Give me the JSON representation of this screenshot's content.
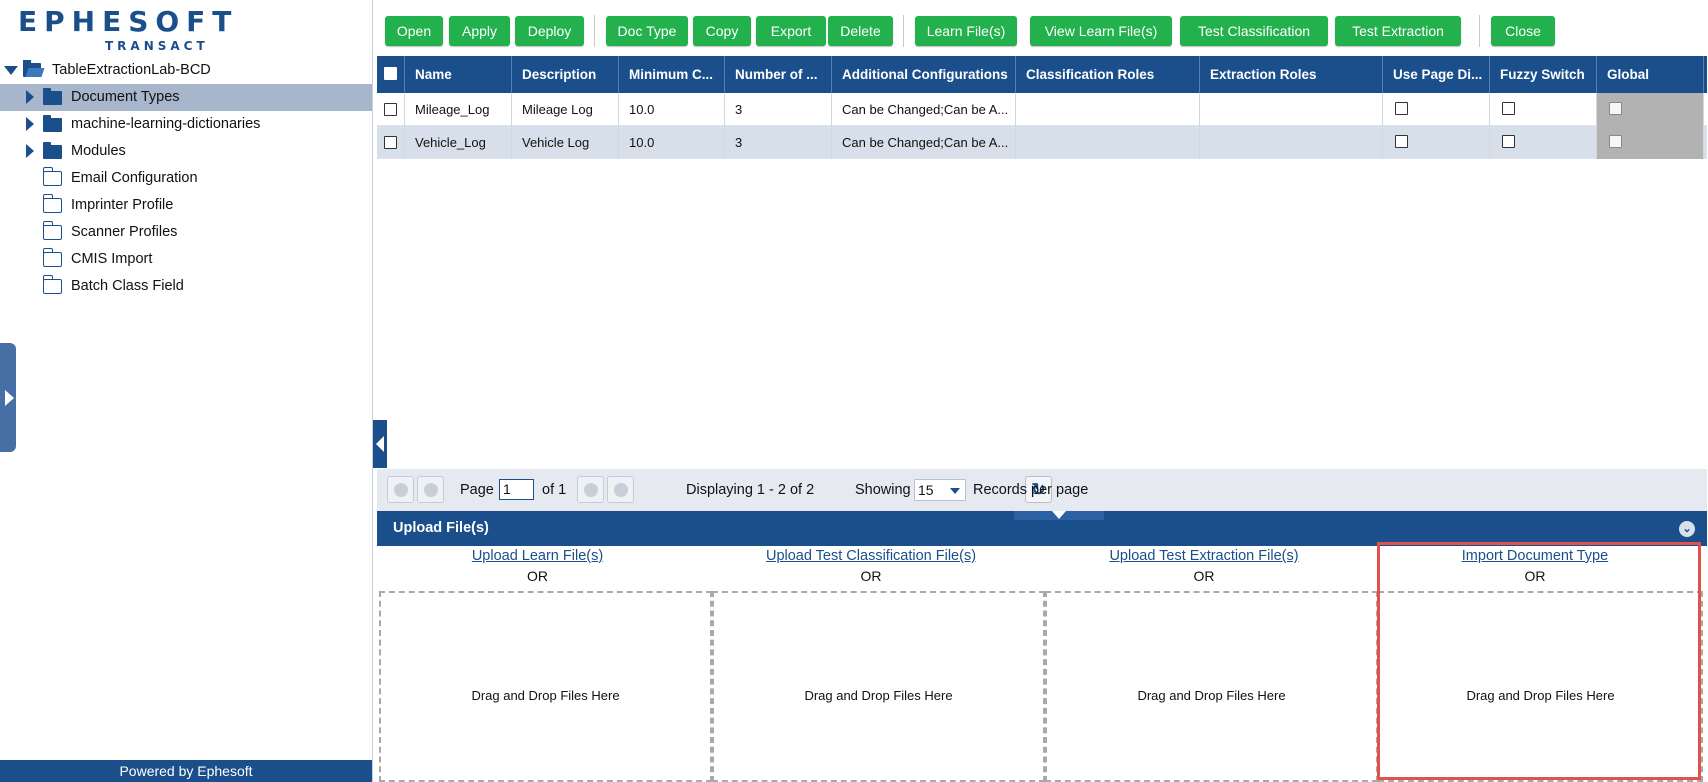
{
  "logo": {
    "line1": "EPHESOFT",
    "line2": "TRANSACT"
  },
  "tree": {
    "root": "TableExtractionLab-BCD",
    "items": [
      {
        "label": "Document Types",
        "selected": true,
        "expandable": true,
        "icon": "folder-solid"
      },
      {
        "label": "machine-learning-dictionaries",
        "selected": false,
        "expandable": true,
        "icon": "folder-solid"
      },
      {
        "label": "Modules",
        "selected": false,
        "expandable": true,
        "icon": "folder-solid"
      },
      {
        "label": "Email Configuration",
        "selected": false,
        "expandable": false,
        "icon": "folder-outline"
      },
      {
        "label": "Imprinter Profile",
        "selected": false,
        "expandable": false,
        "icon": "folder-outline"
      },
      {
        "label": "Scanner Profiles",
        "selected": false,
        "expandable": false,
        "icon": "folder-outline"
      },
      {
        "label": "CMIS Import",
        "selected": false,
        "expandable": false,
        "icon": "folder-outline"
      },
      {
        "label": "Batch Class Field",
        "selected": false,
        "expandable": false,
        "icon": "folder-outline"
      }
    ]
  },
  "footer": {
    "powered": "Powered by Ephesoft"
  },
  "toolbar": {
    "buttons": [
      "Open",
      "Apply",
      "Deploy",
      "Doc Type",
      "Copy",
      "Export",
      "Delete",
      "Learn File(s)",
      "View Learn File(s)",
      "Test Classification",
      "Test Extraction",
      "Close"
    ],
    "accent": "#23b14d"
  },
  "grid": {
    "columns": [
      "Name",
      "Description",
      "Minimum C...",
      "Number of ...",
      "Additional Configurations",
      "Classification Roles",
      "Extraction Roles",
      "Use Page Di...",
      "Fuzzy Switch",
      "Global"
    ],
    "rows": [
      {
        "name": "Mileage_Log",
        "description": "Mileage Log",
        "min_confidence": "10.0",
        "number": "3",
        "additional": "Can be Changed;Can be A...",
        "classification_roles": "",
        "extraction_roles": ""
      },
      {
        "name": "Vehicle_Log",
        "description": "Vehicle Log",
        "min_confidence": "10.0",
        "number": "3",
        "additional": "Can be Changed;Can be A...",
        "classification_roles": "",
        "extraction_roles": ""
      }
    ]
  },
  "pager": {
    "page_label": "Page",
    "page_value": "1",
    "of_label": "of 1",
    "displaying": "Displaying 1 - 2 of 2",
    "showing_label": "Showing",
    "page_size": "15",
    "records_label": "Records per page"
  },
  "upload": {
    "title": "Upload File(s)",
    "or_label": "OR",
    "drop_label": "Drag and Drop Files Here",
    "sections": [
      "Upload Learn File(s)",
      "Upload Test Classification File(s)",
      "Upload Test Extraction File(s)",
      "Import Document Type"
    ],
    "highlight_color": "#e0534c"
  },
  "colors": {
    "brand": "#1a4f8b",
    "selected_row": "#a7b6ca"
  }
}
